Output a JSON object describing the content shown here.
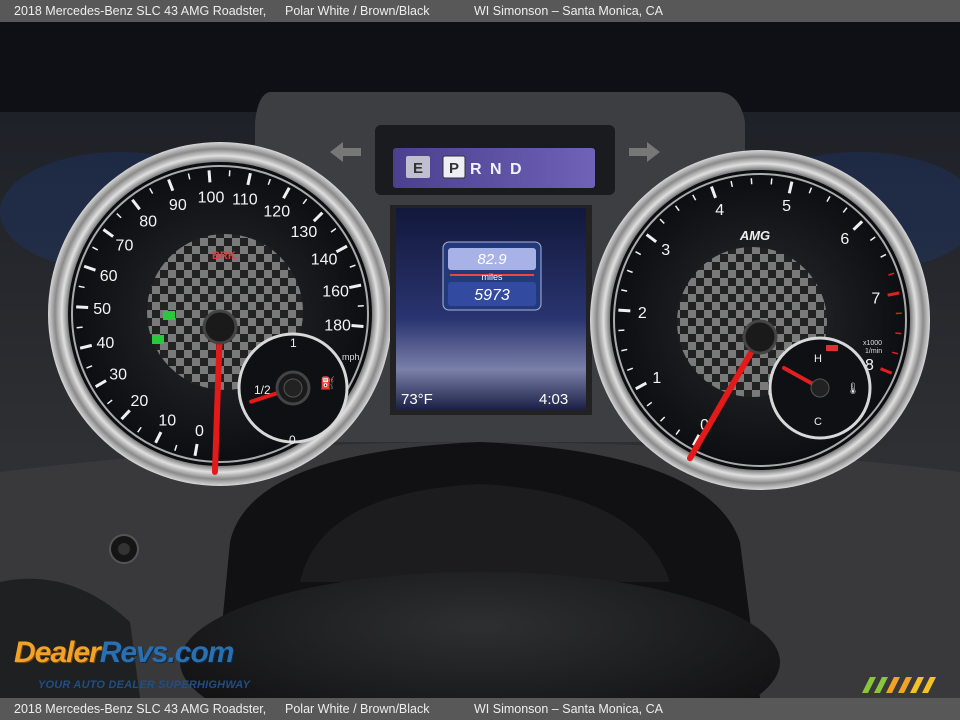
{
  "caption": {
    "vehicle": "2018 Mercedes-Benz SLC 43 AMG Roadster,",
    "color": "Polar White / Brown/Black",
    "dealer": "WI Simonson – Santa Monica, CA"
  },
  "dashboard": {
    "gear_selector": {
      "mode": "E",
      "selected": "P",
      "other": "R N D"
    },
    "odometer": {
      "trip": "82.9",
      "unit": "miles",
      "total": "5973"
    },
    "temperature": "73°F",
    "clock": "4:03",
    "speedometer": {
      "unit": "mph",
      "ticks": [
        "0",
        "10",
        "20",
        "30",
        "40",
        "50",
        "60",
        "70",
        "80",
        "90",
        "100",
        "110",
        "120",
        "130",
        "140",
        "160",
        "180"
      ],
      "brake_label": "BRK",
      "value_mph": 0
    },
    "fuel_gauge": {
      "labels": [
        "1",
        "1/2",
        "0"
      ],
      "level_fraction": 0.45
    },
    "tachometer": {
      "brand": "AMG",
      "unit_top": "x1000",
      "unit_bottom": "1/min",
      "ticks": [
        "0",
        "1",
        "2",
        "3",
        "4",
        "5",
        "6",
        "7",
        "8"
      ],
      "value_rpm": 0
    },
    "coolant_gauge": {
      "labels": [
        "H",
        "C"
      ]
    }
  },
  "watermark": {
    "logo_part1": "Dealer",
    "logo_part2": "Revs",
    "logo_suffix": ".com",
    "tagline": "YOUR AUTO DEALER SUPERHIGHWAY"
  }
}
